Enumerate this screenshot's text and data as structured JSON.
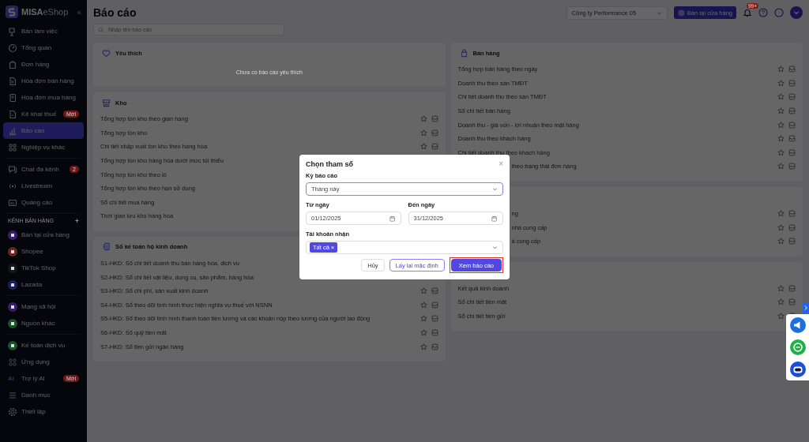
{
  "sidebar": {
    "logo": "MISA",
    "logo_suffix": "eShop",
    "collapse": "«",
    "sections": [
      {
        "items": [
          {
            "label": "Bàn làm việc",
            "selected": false
          },
          {
            "label": "Tổng quan",
            "selected": false
          },
          {
            "label": "Đơn hàng",
            "selected": false
          },
          {
            "label": "Hóa đơn bán hàng",
            "selected": false
          },
          {
            "label": "Hóa đơn mua hàng",
            "selected": false
          },
          {
            "label": "Kê khai thuế",
            "selected": false,
            "badge": "Mới"
          },
          {
            "label": "Báo cáo",
            "selected": true
          },
          {
            "label": "Nghiệp vụ khác",
            "selected": false
          }
        ]
      },
      {
        "items": [
          {
            "label": "Chat đa kênh",
            "selected": false,
            "badge": "2"
          },
          {
            "label": "Livestream",
            "selected": false
          },
          {
            "label": "Quảng cáo",
            "selected": false
          }
        ]
      },
      {
        "label": "KÊNH BÁN HÀNG",
        "add": "+",
        "items": [
          {
            "label": "Bán tại cửa hàng",
            "selected": false,
            "color": "#3a1c6e"
          },
          {
            "label": "Shopee",
            "selected": false,
            "color": "#6a2616"
          },
          {
            "label": "TikTok Shop",
            "selected": false,
            "color": "#181818"
          },
          {
            "label": "Lazada",
            "selected": false,
            "color": "#1a2060"
          }
        ]
      },
      {
        "items": [
          {
            "label": "Mạng xã hội",
            "selected": false,
            "color": "#3a1c6e"
          },
          {
            "label": "Nguồn khác",
            "selected": false,
            "color": "#1a5228"
          }
        ]
      },
      {
        "items": [
          {
            "label": "Kế toán dịch vụ",
            "selected": false,
            "color": "#1a5228"
          },
          {
            "label": "Ứng dụng",
            "selected": false
          },
          {
            "label": "Trợ lý AI",
            "selected": false,
            "badge": "Mới",
            "icon_text": "Ai"
          },
          {
            "label": "Danh mục",
            "selected": false
          },
          {
            "label": "Thiết lập",
            "selected": false
          }
        ]
      }
    ]
  },
  "header": {
    "title": "Báo cáo",
    "company": "Công ty Performance 05",
    "store_button": "Bán tại cửa hàng",
    "notifications": "99+"
  },
  "search": {
    "placeholder": "Nhập tên báo cáo"
  },
  "columns": [
    [
      {
        "title": "Yêu thích",
        "empty_text": "Chưa có báo cáo yêu thích"
      },
      {
        "title": "Kho",
        "rows": [
          {
            "label": "Tổng hợp tồn kho theo gian hàng",
            "partial": false
          },
          {
            "label": "Tổng hợp tồn kho",
            "partial": false
          },
          {
            "label": "Chi tiết nhập xuất tồn kho theo hàng hóa",
            "partial": false
          },
          {
            "label": "Tổng hợp tồn kho hàng hóa dưới mức tối thiểu",
            "partial": false,
            "icons_hidden": true
          },
          {
            "label": "Tổng hợp tồn kho theo lô",
            "partial": false,
            "icons_hidden": true
          },
          {
            "label": "Tổng hợp tồn kho theo hạn sử dụng",
            "partial": false,
            "icons_hidden": true
          },
          {
            "label": "Sổ chi tiết mua hàng",
            "partial": false,
            "icons_hidden": true
          },
          {
            "label": "Thời gian lưu kho hàng hóa",
            "partial": false,
            "icons_hidden": true
          }
        ]
      },
      {
        "title": "Sổ kế toán hộ kinh doanh",
        "rows": [
          {
            "label": "S1-HKD: Sổ chi tiết doanh thu bán hàng hóa, dịch vụ",
            "partial": false,
            "icons_hidden": true
          },
          {
            "label": "S2-HKD: Sổ chi tiết vật liệu, dụng cụ, sản phẩm, hàng hóa",
            "partial": false,
            "icons_hidden": true
          },
          {
            "label": "S3-HKD: Sổ chi phí, sản xuất kinh doanh",
            "partial": false
          },
          {
            "label": "S4-HKD: Sổ theo dõi tình hình thực hiện nghĩa vụ thuế với NSNN",
            "partial": false
          },
          {
            "label": "S5-HKD: Sổ theo dõi tình hình thanh toán tiền lương và các khoản nộp theo lương của người lao động",
            "partial": false
          },
          {
            "label": "S6-HKD: Sổ quỹ tiền mặt",
            "partial": false
          },
          {
            "label": "S7-HKD: Sổ tiền gửi ngân hàng",
            "partial": false
          }
        ]
      }
    ],
    [
      {
        "title": "Bán hàng",
        "rows": [
          {
            "label": "Tổng hợp bán hàng theo ngày",
            "partial": false
          },
          {
            "label": "Doanh thu theo sàn TMĐT",
            "partial": false
          },
          {
            "label": "Chi tiết doanh thu theo sàn TMĐT",
            "partial": false
          },
          {
            "label": "Sổ chi tiết bán hàng",
            "partial": false
          },
          {
            "label": "Doanh thu - giá vốn - lợi nhuận theo mặt hàng",
            "partial": false
          },
          {
            "label": "Doanh thu theo khách hàng",
            "partial": false
          },
          {
            "label": "Chi tiết doanh thu theo khách hàng",
            "partial": false
          },
          {
            "label": "theo trạng thái đơn hàng",
            "partial": true
          }
        ]
      },
      {
        "rows": [
          {
            "label": "ng",
            "partial": true
          },
          {
            "label": "nhà cung cấp",
            "partial": true
          },
          {
            "label": "à cung cấp",
            "partial": true
          }
        ]
      },
      {
        "rows": [
          {
            "label": "Kết quả kinh doanh",
            "partial": false
          },
          {
            "label": "Sổ chi tiết tiền mặt",
            "partial": false
          },
          {
            "label": "Sổ chi tiết tiền gửi",
            "partial": false
          }
        ]
      }
    ]
  ],
  "dialog": {
    "title": "Chọn tham số",
    "close": "×",
    "period_label": "Kỳ báo cáo",
    "period_value": "Tháng này",
    "from_label": "Từ ngày",
    "from_value": "01/12/2025",
    "to_label": "Đến ngày",
    "to_value": "31/12/2025",
    "accounts_label": "Tài khoản nhận",
    "tags": [
      {
        "label": "Tất cả",
        "remove": "×"
      }
    ],
    "buttons": [
      {
        "label": "Hủy",
        "kind": "plain"
      },
      {
        "label": "Lấy lại mặc định",
        "kind": "outline"
      },
      {
        "label": "Xem báo cáo",
        "kind": "primary",
        "highlighted": true
      }
    ]
  }
}
